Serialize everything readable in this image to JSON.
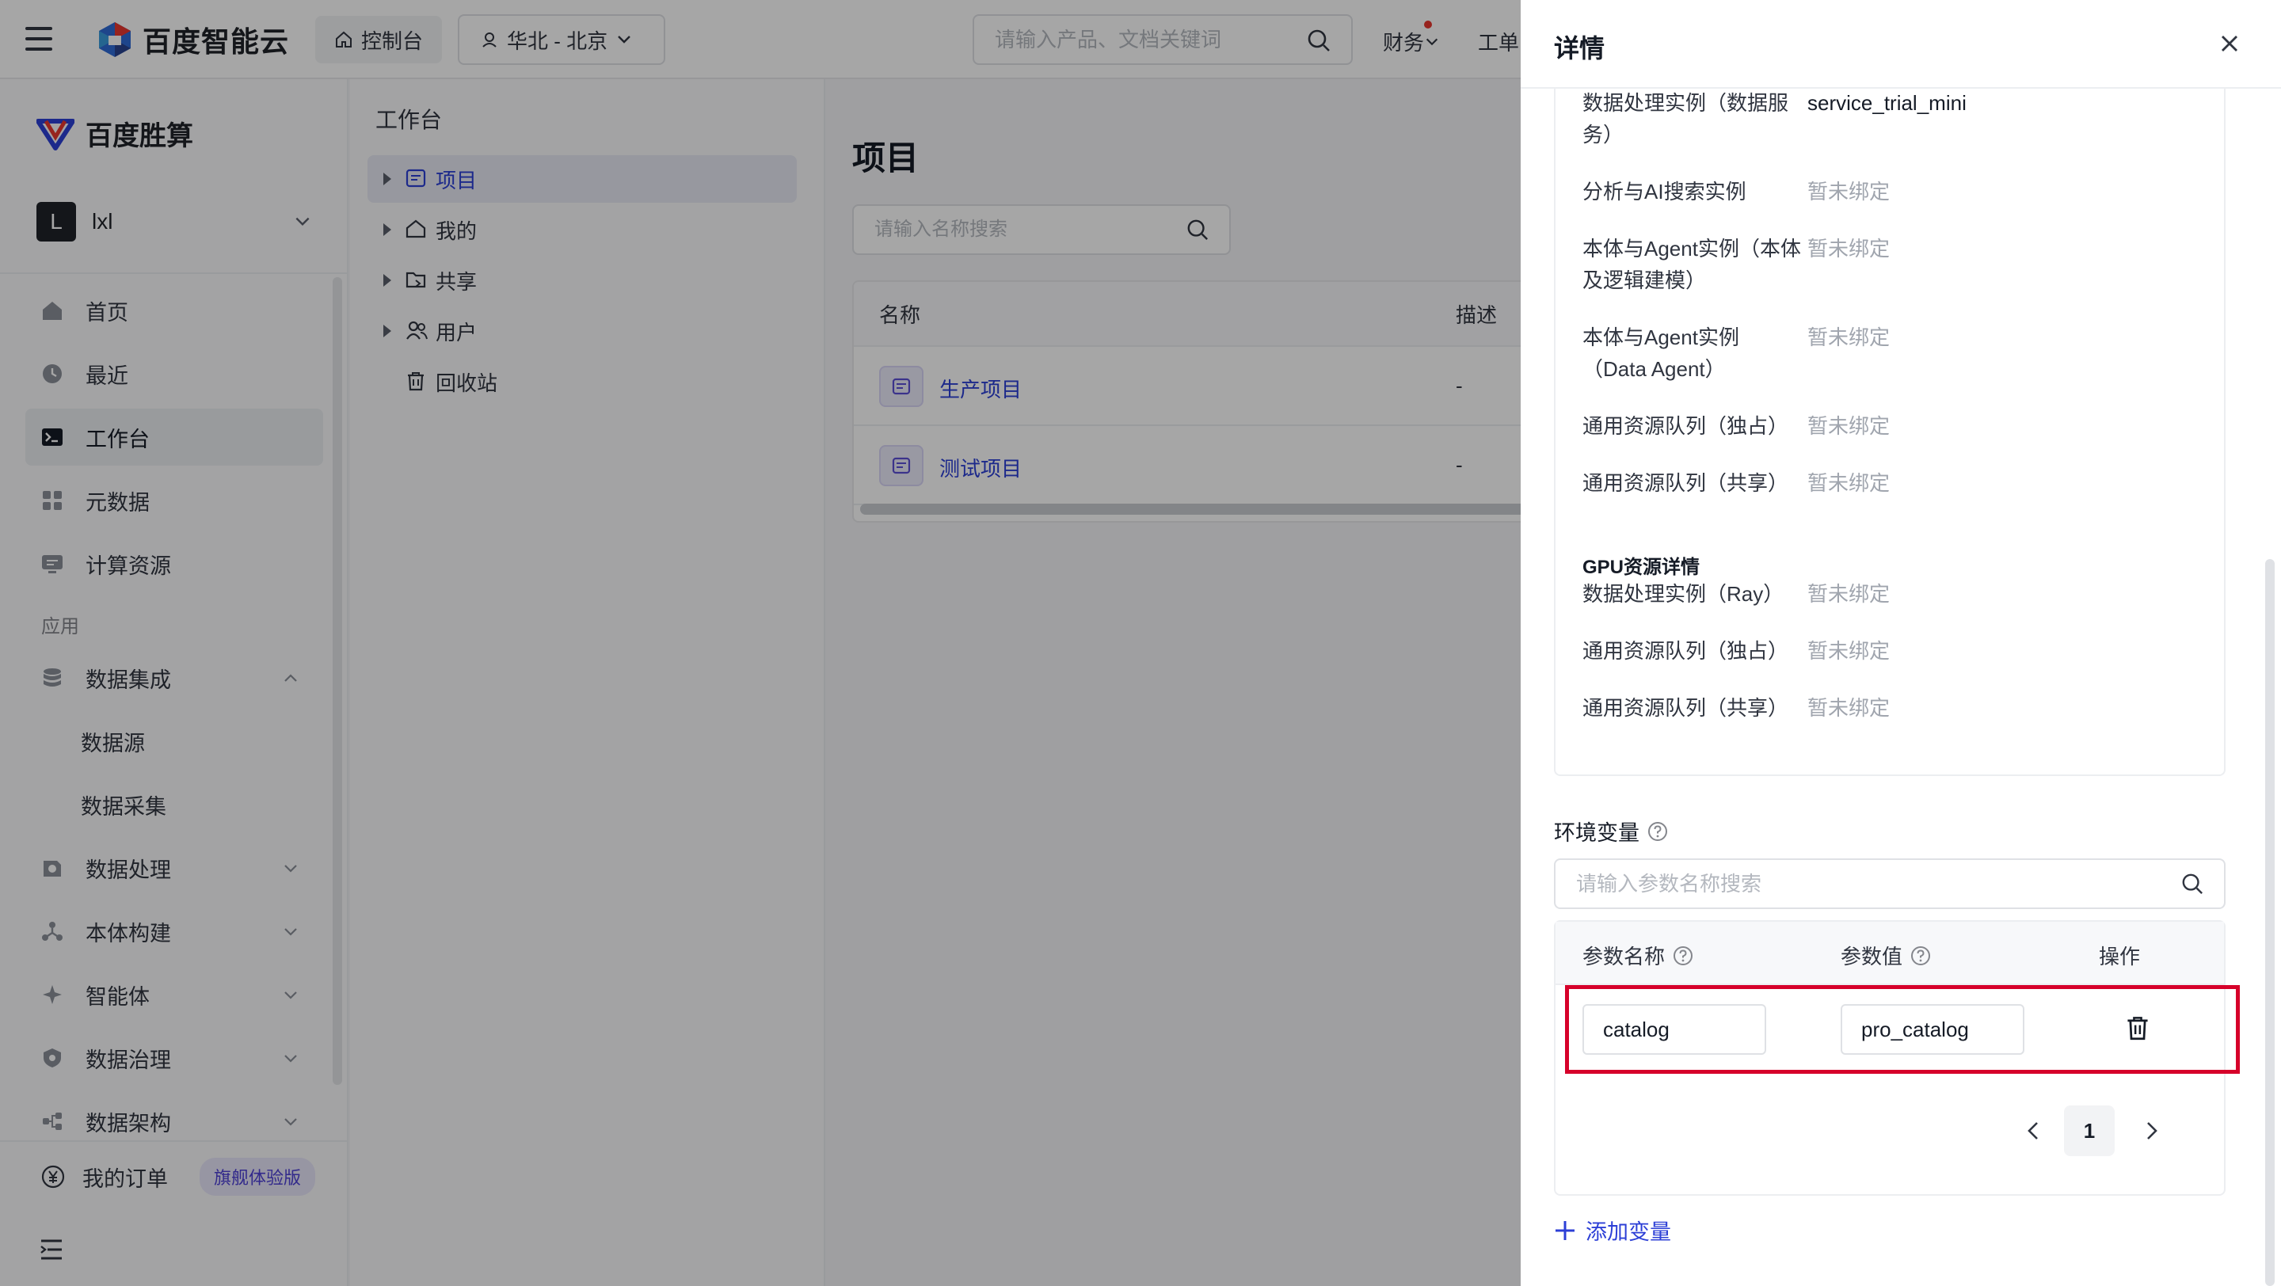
{
  "topbar": {
    "logo_text": "百度智能云",
    "console_label": "控制台",
    "region_label": "华北 - 北京",
    "search_placeholder": "请输入产品、文档关键词",
    "finance_label": "财务",
    "ticket_label": "工单"
  },
  "leftnav": {
    "brand": "百度胜算",
    "workspace_avatar": "L",
    "workspace_name": "lxl",
    "items": [
      {
        "label": "首页",
        "icon": "home-icon"
      },
      {
        "label": "最近",
        "icon": "clock-icon"
      },
      {
        "label": "工作台",
        "icon": "terminal-icon",
        "active": true
      },
      {
        "label": "元数据",
        "icon": "grid-icon"
      },
      {
        "label": "计算资源",
        "icon": "monitor-icon"
      }
    ],
    "group_label": "应用",
    "app_items": [
      {
        "label": "数据集成",
        "icon": "database-icon",
        "expanded": true
      },
      {
        "label": "数据源",
        "sub": true
      },
      {
        "label": "数据采集",
        "sub": true
      },
      {
        "label": "数据处理",
        "icon": "process-icon"
      },
      {
        "label": "本体构建",
        "icon": "nodes-icon"
      },
      {
        "label": "智能体",
        "icon": "sparkle-icon"
      },
      {
        "label": "数据治理",
        "icon": "shield-icon"
      },
      {
        "label": "数据架构",
        "icon": "architecture-icon"
      }
    ],
    "order_label": "我的订单",
    "order_badge": "旗舰体验版"
  },
  "tree": {
    "title": "工作台",
    "items": [
      {
        "label": "项目",
        "active": true,
        "arrow": true
      },
      {
        "label": "我的",
        "arrow": true
      },
      {
        "label": "共享",
        "arrow": true
      },
      {
        "label": "用户",
        "arrow": true
      },
      {
        "label": "回收站",
        "arrow": false
      }
    ]
  },
  "main": {
    "title": "项目",
    "search_placeholder": "请输入名称搜索",
    "columns": [
      "名称",
      "描述"
    ],
    "rows": [
      {
        "name": "生产项目",
        "desc": "-"
      },
      {
        "name": "测试项目",
        "desc": "-"
      }
    ]
  },
  "drawer": {
    "title": "详情",
    "kv": [
      {
        "k1": "数据处理实例（数据服",
        "k2": "务）",
        "v": "service_trial_mini",
        "muted": false
      },
      {
        "k1": "分析与AI搜索实例",
        "v": "暂未绑定",
        "muted": true
      },
      {
        "k1": "本体与Agent实例（本体",
        "k2": "及逻辑建模）",
        "v": "暂未绑定",
        "muted": true
      },
      {
        "k1": "本体与Agent实例",
        "k2": "（Data Agent）",
        "v": "暂未绑定",
        "muted": true
      },
      {
        "k1": "通用资源队列（独占）",
        "v": "暂未绑定",
        "muted": true
      },
      {
        "k1": "通用资源队列（共享）",
        "v": "暂未绑定",
        "muted": true
      }
    ],
    "gpu_title": "GPU资源详情",
    "gpu_kv": [
      {
        "k1": "数据处理实例（Ray）",
        "v": "暂未绑定"
      },
      {
        "k1": "通用资源队列（独占）",
        "v": "暂未绑定"
      },
      {
        "k1": "通用资源队列（共享）",
        "v": "暂未绑定"
      }
    ],
    "env_label": "环境变量",
    "env_search_placeholder": "请输入参数名称搜索",
    "param_headers": {
      "name": "参数名称",
      "value": "参数值",
      "op": "操作"
    },
    "param_row": {
      "name": "catalog",
      "value": "pro_catalog"
    },
    "page": "1",
    "add_var_label": "添加变量"
  },
  "colors": {
    "accent": "#2c3fd6",
    "highlight": "#d6002a",
    "muted": "#a0a5ae"
  }
}
